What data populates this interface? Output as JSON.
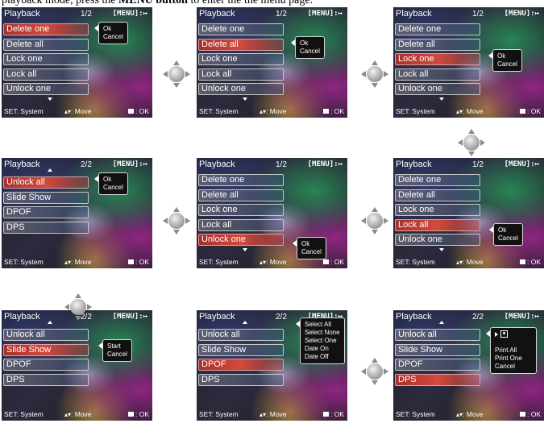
{
  "caption": {
    "prefix": "playback mode, press the ",
    "bold": "MENU button",
    "suffix": " to enter the the menu page."
  },
  "screen_common": {
    "title": "Playback",
    "menu_label": "[MENU]:↦",
    "footer_set": "SET: System",
    "footer_move": ": Move",
    "footer_ok": ": OK"
  },
  "screens": [
    {
      "page": "1/2",
      "items": [
        "Delete one",
        "Delete all",
        "Lock one",
        "Lock all",
        "Unlock one"
      ],
      "selected": 0,
      "popup": [
        "Ok",
        "Cancel"
      ]
    },
    {
      "page": "1/2",
      "items": [
        "Delete one",
        "Delete all",
        "Lock one",
        "Lock all",
        "Unlock one"
      ],
      "selected": 1,
      "popup": [
        "Ok",
        "Cancel"
      ]
    },
    {
      "page": "1/2",
      "items": [
        "Delete one",
        "Delete all",
        "Lock one",
        "Lock all",
        "Unlock one"
      ],
      "selected": 2,
      "popup": [
        "Ok",
        "Cancel"
      ]
    },
    {
      "page": "2/2",
      "items": [
        "Unlock all",
        "Slide Show",
        "DPOF",
        "DPS"
      ],
      "selected": 0,
      "popup": [
        "Ok",
        "Cancel"
      ]
    },
    {
      "page": "1/2",
      "items": [
        "Delete one",
        "Delete all",
        "Lock one",
        "Lock all",
        "Unlock one"
      ],
      "selected": 4,
      "popup": [
        "Ok",
        "Cancel"
      ]
    },
    {
      "page": "1/2",
      "items": [
        "Delete one",
        "Delete all",
        "Lock one",
        "Lock all",
        "Unlock one"
      ],
      "selected": 3,
      "popup": [
        "Ok",
        "Cancel"
      ]
    },
    {
      "page": "2/2",
      "items": [
        "Unlock all",
        "Slide Show",
        "DPOF",
        "DPS"
      ],
      "selected": 1,
      "popup": [
        "Start",
        "Cancel"
      ]
    },
    {
      "page": "2/2",
      "items": [
        "Unlock all",
        "Slide Show",
        "DPOF",
        "DPS"
      ],
      "selected": 2,
      "popup": [
        "Select All",
        "Select None",
        "Select One",
        "Date On",
        "Date Off"
      ]
    },
    {
      "page": "2/2",
      "items": [
        "Unlock all",
        "Slide Show",
        "DPOF",
        "DPS"
      ],
      "selected": 3,
      "popup": [
        "Print All",
        "Print One",
        "Cancel"
      ]
    }
  ],
  "colors": {
    "selected_item": "#c8403a",
    "item_border": "#c9c9c9",
    "popup_bg": "#111111"
  },
  "icons": {
    "nav_control": "four-way-navigation-pad-icon",
    "print": "printer-icon"
  }
}
